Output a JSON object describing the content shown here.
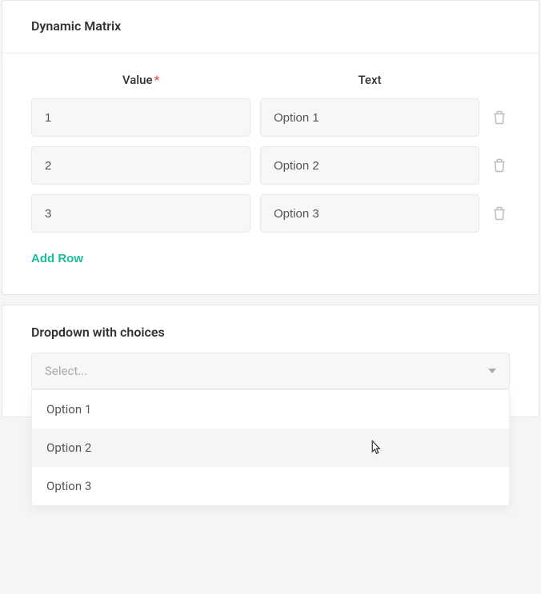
{
  "matrix": {
    "title": "Dynamic Matrix",
    "headers": {
      "value": "Value",
      "text": "Text"
    },
    "rows": [
      {
        "value": "1",
        "text": "Option 1"
      },
      {
        "value": "2",
        "text": "Option 2"
      },
      {
        "value": "3",
        "text": "Option 3"
      }
    ],
    "add_row_label": "Add Row"
  },
  "dropdown": {
    "title": "Dropdown with choices",
    "placeholder": "Select...",
    "options": [
      "Option 1",
      "Option 2",
      "Option 3"
    ],
    "hovered_index": 1
  }
}
